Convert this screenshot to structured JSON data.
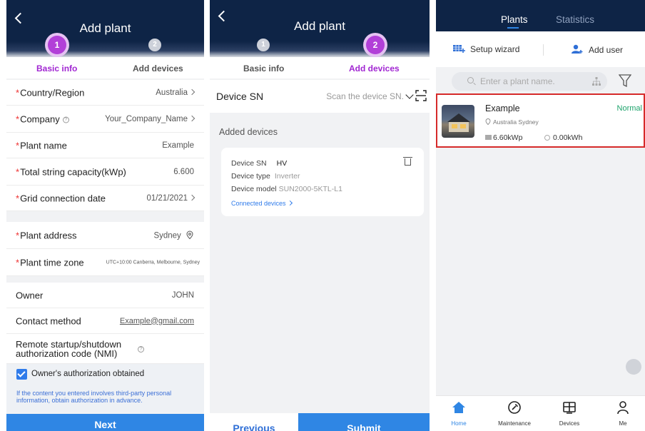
{
  "screen1": {
    "title": "Add plant",
    "steps": [
      {
        "num": "1",
        "label": "Basic info"
      },
      {
        "num": "2",
        "label": "Add devices"
      }
    ],
    "fields": [
      {
        "label": "Country/Region",
        "value": "Australia",
        "required": true
      },
      {
        "label": "Company",
        "value": "Your_Company_Name",
        "required": true
      },
      {
        "label": "Plant name",
        "value": "Example",
        "required": true
      },
      {
        "label": "Total string capacity(kWp)",
        "value": "6.600",
        "required": true
      },
      {
        "label": "Grid connection date",
        "value": "01/21/2021",
        "required": true
      },
      {
        "label": "Plant address",
        "value": "Sydney",
        "required": true
      },
      {
        "label": "Plant time zone",
        "value": "UTC+10:00 Canberra, Melbourne, Sydney",
        "required": true
      },
      {
        "label": "Owner",
        "value": "JOHN",
        "required": false
      },
      {
        "label": "Contact method",
        "value": "Example@gmail.com",
        "required": false
      },
      {
        "label": "Remote startup/shutdown authorization code (NMI)",
        "value": "",
        "required": false
      }
    ],
    "checkbox_label": "Owner's authorization obtained",
    "checkbox_checked": true,
    "notice": "If the content you entered involves third-party personal information, obtain authorization in advance.",
    "next_button": "Next"
  },
  "screen2": {
    "title": "Add plant",
    "steps": [
      {
        "num": "1",
        "label": "Basic info"
      },
      {
        "num": "2",
        "label": "Add devices"
      }
    ],
    "device_sn_label": "Device SN",
    "device_sn_placeholder": "Scan the device SN.",
    "added_devices_title": "Added devices",
    "card": {
      "sn_label": "Device SN",
      "sn_value": "HV",
      "type_label": "Device type",
      "type_value": "Inverter",
      "model_label": "Device model",
      "model_value": "SUN2000-5KTL-L1",
      "link": "Connected devices"
    },
    "previous_button": "Previous",
    "submit_button": "Submit"
  },
  "screen3": {
    "tabs": [
      "Plants",
      "Statistics"
    ],
    "actions": {
      "setup_wizard": "Setup wizard",
      "add_user": "Add user"
    },
    "search_placeholder": "Enter a plant name.",
    "plant": {
      "name": "Example",
      "location": "Australia Sydney",
      "status": "Normal",
      "capacity": "6.60kWp",
      "energy": "0.00kWh"
    },
    "nav": [
      "Home",
      "Maintenance",
      "Devices",
      "Me"
    ],
    "colors": {
      "header": "#0e2446",
      "accent": "#2f86e4",
      "status_normal": "#1ea36c",
      "step_active": "#b23fd8"
    }
  }
}
